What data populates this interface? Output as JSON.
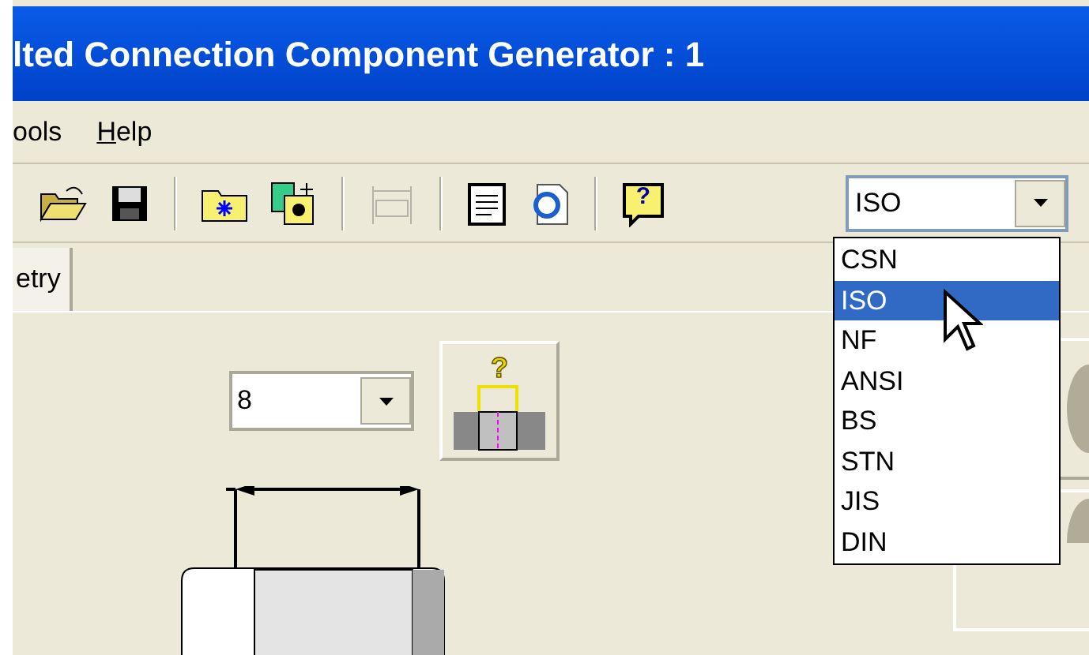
{
  "window": {
    "title": "lted Connection Component Generator : 1"
  },
  "menu": [
    {
      "label": "ools",
      "mnemonic": false
    },
    {
      "label": "Help",
      "mnemonic": true
    }
  ],
  "toolbar": [
    {
      "kind": "open",
      "disabled": false
    },
    {
      "kind": "save",
      "disabled": false
    },
    {
      "kind": "sep"
    },
    {
      "kind": "folder",
      "disabled": false
    },
    {
      "kind": "new",
      "disabled": false
    },
    {
      "kind": "sep"
    },
    {
      "kind": "dimension",
      "disabled": true
    },
    {
      "kind": "sep"
    },
    {
      "kind": "notes",
      "disabled": false
    },
    {
      "kind": "web",
      "disabled": false
    },
    {
      "kind": "sep"
    },
    {
      "kind": "help",
      "disabled": false,
      "glyph": "?"
    }
  ],
  "standard": {
    "value": "ISO",
    "expanded": true,
    "options": [
      {
        "label": "CSN",
        "selected": false
      },
      {
        "label": "ISO",
        "selected": true
      },
      {
        "label": "NF",
        "selected": false
      },
      {
        "label": "ANSI",
        "selected": false
      },
      {
        "label": "BS",
        "selected": false
      },
      {
        "label": "STN",
        "selected": false
      },
      {
        "label": "JIS",
        "selected": false
      },
      {
        "label": "DIN",
        "selected": false
      }
    ]
  },
  "tabs": [
    {
      "label": "etry",
      "selected": true
    }
  ],
  "size": {
    "value": "8"
  },
  "dimension_button": {
    "label": "?"
  }
}
